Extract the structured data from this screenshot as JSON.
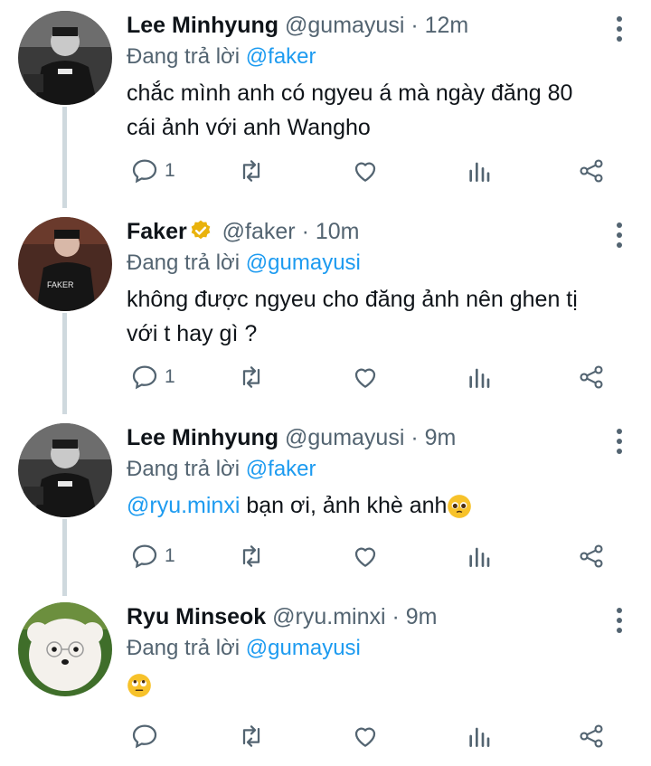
{
  "tweets": [
    {
      "name": "Lee Minhyung",
      "handle": "@gumayusi",
      "time": "· 12m",
      "reply_prefix": "Đang trả lời",
      "reply_to": "@faker",
      "text": "chắc mình anh có ngyeu á mà ngày đăng 80 cái ảnh với anh Wangho",
      "reply_count": "1",
      "avatar": "gumayusi-avatar"
    },
    {
      "name": "Faker",
      "handle": "@faker",
      "time": "· 10m",
      "reply_prefix": "Đang trả lời",
      "reply_to": "@gumayusi",
      "text": "không được ngyeu cho đăng ảnh nên ghen tị với t hay gì ?",
      "reply_count": "1",
      "verified": true,
      "avatar": "faker-avatar",
      "jersey_text": "FAKER"
    },
    {
      "name": "Lee Minhyung",
      "handle": "@gumayusi",
      "time": "· 9m",
      "reply_prefix": "Đang trả lời",
      "reply_to": "@faker",
      "text_mention": "@ryu.minxi",
      "text": " bạn ơi, ảnh khè anh",
      "emoji": "pleading-face-emoji",
      "reply_count": "1",
      "avatar": "gumayusi-avatar"
    },
    {
      "name": "Ryu Minseok",
      "handle": "@ryu.minxi",
      "time": "· 9m",
      "reply_prefix": "Đang trả lời",
      "reply_to": "@gumayusi",
      "emoji": "eye-roll-emoji",
      "reply_count": "",
      "avatar": "dog-avatar"
    }
  ],
  "colors": {
    "link": "#1d9bf0",
    "muted": "#536471",
    "thread_line": "#cfd9de",
    "verified": "#e9b20c"
  }
}
